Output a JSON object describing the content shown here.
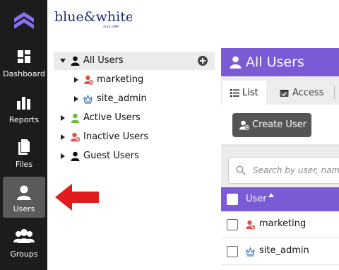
{
  "brand": {
    "text": "blue&white",
    "tagline": "since 1999"
  },
  "nav": {
    "items": [
      {
        "label": "Dashboard",
        "icon": "dashboard-icon"
      },
      {
        "label": "Reports",
        "icon": "bar-chart-icon"
      },
      {
        "label": "Files",
        "icon": "files-icon"
      },
      {
        "label": "Users",
        "icon": "user-icon",
        "active": true
      },
      {
        "label": "Groups",
        "icon": "groups-icon"
      }
    ]
  },
  "tree": {
    "items": [
      {
        "label": "All Users",
        "expanded": true,
        "icon": "user-icon"
      },
      {
        "label": "marketing",
        "icon": "user-ban-icon"
      },
      {
        "label": "site_admin",
        "icon": "crown-icon"
      },
      {
        "label": "Active Users",
        "icon": "user-green-icon"
      },
      {
        "label": "Inactive Users",
        "icon": "user-ban-icon"
      },
      {
        "label": "Guest Users",
        "icon": "user-icon"
      }
    ]
  },
  "main": {
    "title": "All Users",
    "tabs": [
      {
        "label": "List",
        "active": true,
        "icon": "list-icon"
      },
      {
        "label": "Access",
        "active": false,
        "icon": "access-icon"
      }
    ],
    "create_button": "Create User",
    "search_placeholder": "Search by user, name",
    "table": {
      "column": "User",
      "sort": "ascending",
      "rows": [
        {
          "name": "marketing",
          "icon": "user-ban-icon"
        },
        {
          "name": "site_admin",
          "icon": "crown-icon"
        }
      ]
    }
  },
  "colors": {
    "nav_bg": "#1c1c1c",
    "accent": "#7b5ad6",
    "brand_blue": "#1f2f6b",
    "arrow": "#e21c1c",
    "inactive_user": "#d9534f",
    "active_user": "#6cbf3b",
    "admin": "#4a7fd4"
  }
}
